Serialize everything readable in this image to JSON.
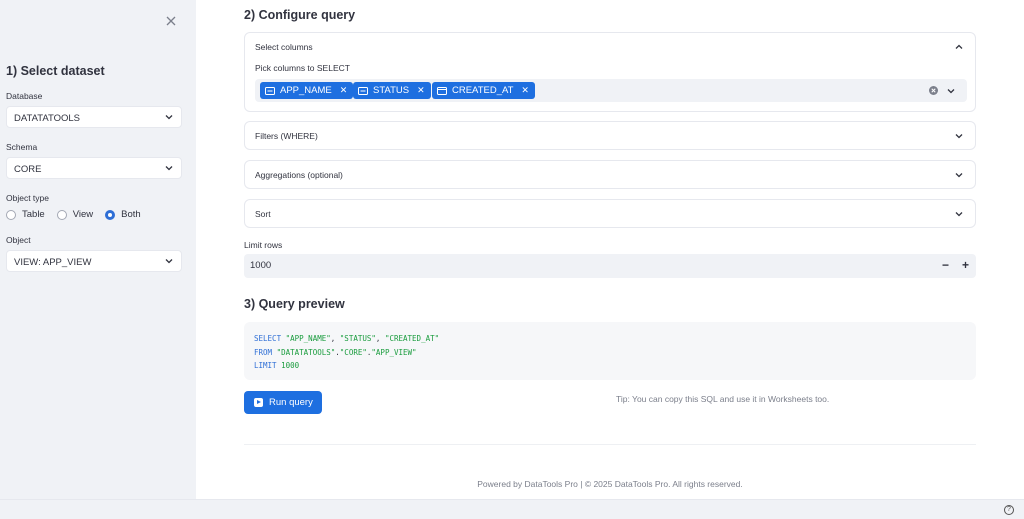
{
  "sidebar": {
    "title": "1) Select dataset",
    "database_label": "Database",
    "database_value": "DATATATOOLS",
    "schema_label": "Schema",
    "schema_value": "CORE",
    "object_type_label": "Object type",
    "object_type_options": [
      "Table",
      "View",
      "Both"
    ],
    "object_type_selected": "Both",
    "object_label": "Object",
    "object_value": "VIEW: APP_VIEW"
  },
  "configure": {
    "title": "2) Configure query",
    "select_columns": {
      "title": "Select columns",
      "pick_label": "Pick columns to SELECT",
      "chips": [
        {
          "label": "APP_NAME",
          "icon": "text-column-icon"
        },
        {
          "label": "STATUS",
          "icon": "text-column-icon"
        },
        {
          "label": "CREATED_AT",
          "icon": "calendar-icon"
        }
      ]
    },
    "filters_title": "Filters (WHERE)",
    "aggregations_title": "Aggregations (optional)",
    "sort_title": "Sort",
    "limit_label": "Limit rows",
    "limit_value": "1000",
    "minus": "−",
    "plus": "+"
  },
  "preview": {
    "title": "3) Query preview",
    "sql": {
      "line1_kw": "SELECT",
      "line1_a": "\"APP_NAME\"",
      "line1_b": "\"STATUS\"",
      "line1_c": "\"CREATED_AT\"",
      "line2_kw": "FROM",
      "line2_a": "\"DATATATOOLS\"",
      "line2_b": "\"CORE\"",
      "line2_c": "\"APP_VIEW\"",
      "line3_kw": "LIMIT",
      "line3_num": "1000"
    },
    "run_label": "Run query",
    "tip": "Tip: You can copy this SQL and use it in Worksheets too."
  },
  "footer": "Powered by DataTools Pro | © 2025 DataTools Pro. All rights reserved.",
  "colors": {
    "accent": "#1e6fe0",
    "sidebar_bg": "#f0f2f6",
    "sql_keyword": "#2f6fd6",
    "sql_string": "#1a9c3e"
  }
}
